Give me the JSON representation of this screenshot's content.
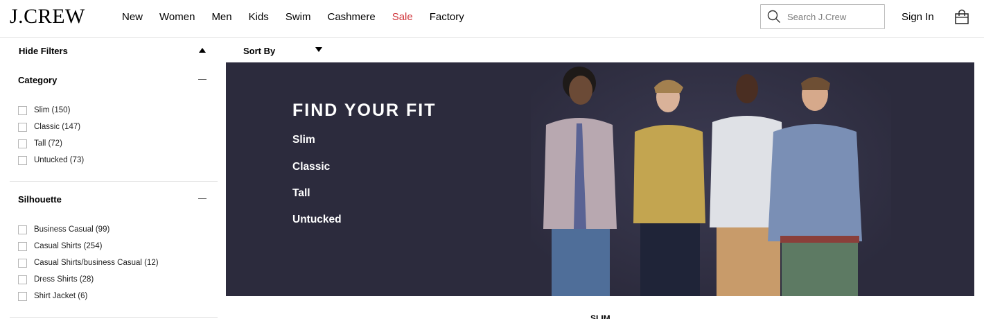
{
  "header": {
    "logo": "J.CREW",
    "nav": [
      "New",
      "Women",
      "Men",
      "Kids",
      "Swim",
      "Cashmere",
      "Sale",
      "Factory"
    ],
    "search_placeholder": "Search J.Crew",
    "sign_in": "Sign In",
    "icons": {
      "search": "search-icon",
      "bag": "shopping-bag-icon"
    },
    "sale_color": "#d0363c"
  },
  "filterbar": {
    "hide_filters": "Hide Filters",
    "sort_by": "Sort By"
  },
  "filters": {
    "category": {
      "title": "Category",
      "options": [
        "Slim (150)",
        "Classic (147)",
        "Tall (72)",
        "Untucked (73)"
      ]
    },
    "silhouette": {
      "title": "Silhouette",
      "options": [
        "Business Casual (99)",
        "Casual Shirts (254)",
        "Casual Shirts/business Casual (12)",
        "Dress Shirts (28)",
        "Shirt Jacket (6)"
      ]
    }
  },
  "hero": {
    "title": "FIND YOUR FIT",
    "links": [
      "Slim",
      "Classic",
      "Tall",
      "Untucked"
    ],
    "background": "#2c2b3d"
  },
  "below": {
    "partial_text": "SLIM"
  }
}
